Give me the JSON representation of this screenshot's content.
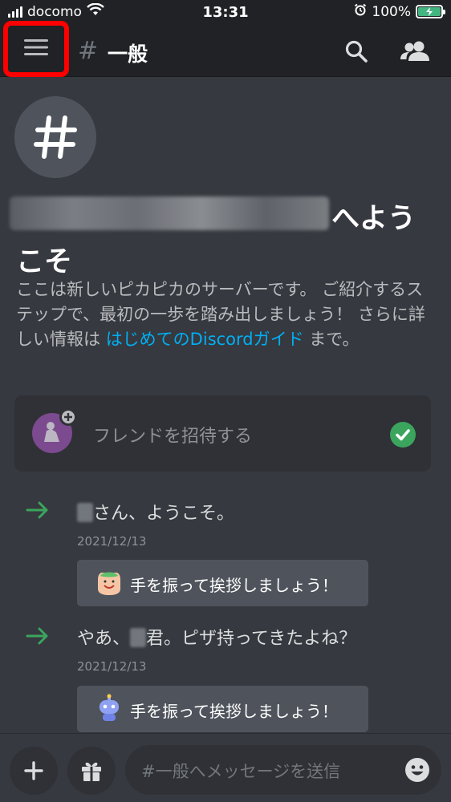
{
  "status": {
    "carrier": "docomo",
    "time": "13:31",
    "battery": "100%"
  },
  "header": {
    "hash": "#",
    "channel": "一般"
  },
  "welcome": {
    "big_hash": "#",
    "title_suffix": "へよう",
    "title_line2": "こそ",
    "desc_plain": "ここは新しいピカピカのサーバーです。 ご紹介するステップで、最初の一歩を踏み出しましょう！ さらに詳しい情報は ",
    "desc_link": "はじめてのDiscordガイド",
    "desc_tail": " まで。"
  },
  "invite": {
    "label": "フレンドを招待する"
  },
  "messages": [
    {
      "text": "さん、ようこそ。",
      "date": "2021/12/13",
      "button": "手を振って挨拶しましょう！"
    },
    {
      "text_pre": "やあ、",
      "text_post": "君。ピザ持ってきたよね？",
      "date": "2021/12/13",
      "button": "手を振って挨拶しましょう！"
    }
  ],
  "composer": {
    "placeholder": "#一般へメッセージを送信"
  },
  "icons": [
    "hamburger-menu-icon",
    "search-icon",
    "members-icon",
    "plus-icon",
    "gift-icon",
    "emoji-icon",
    "check-icon",
    "arrow-right-icon",
    "wifi-icon",
    "alarm-icon",
    "battery-icon"
  ],
  "colors": {
    "background": "#36393f",
    "header": "#202225",
    "link": "#00aff4",
    "green": "#3ba55d",
    "highlight": "#ff0000"
  }
}
